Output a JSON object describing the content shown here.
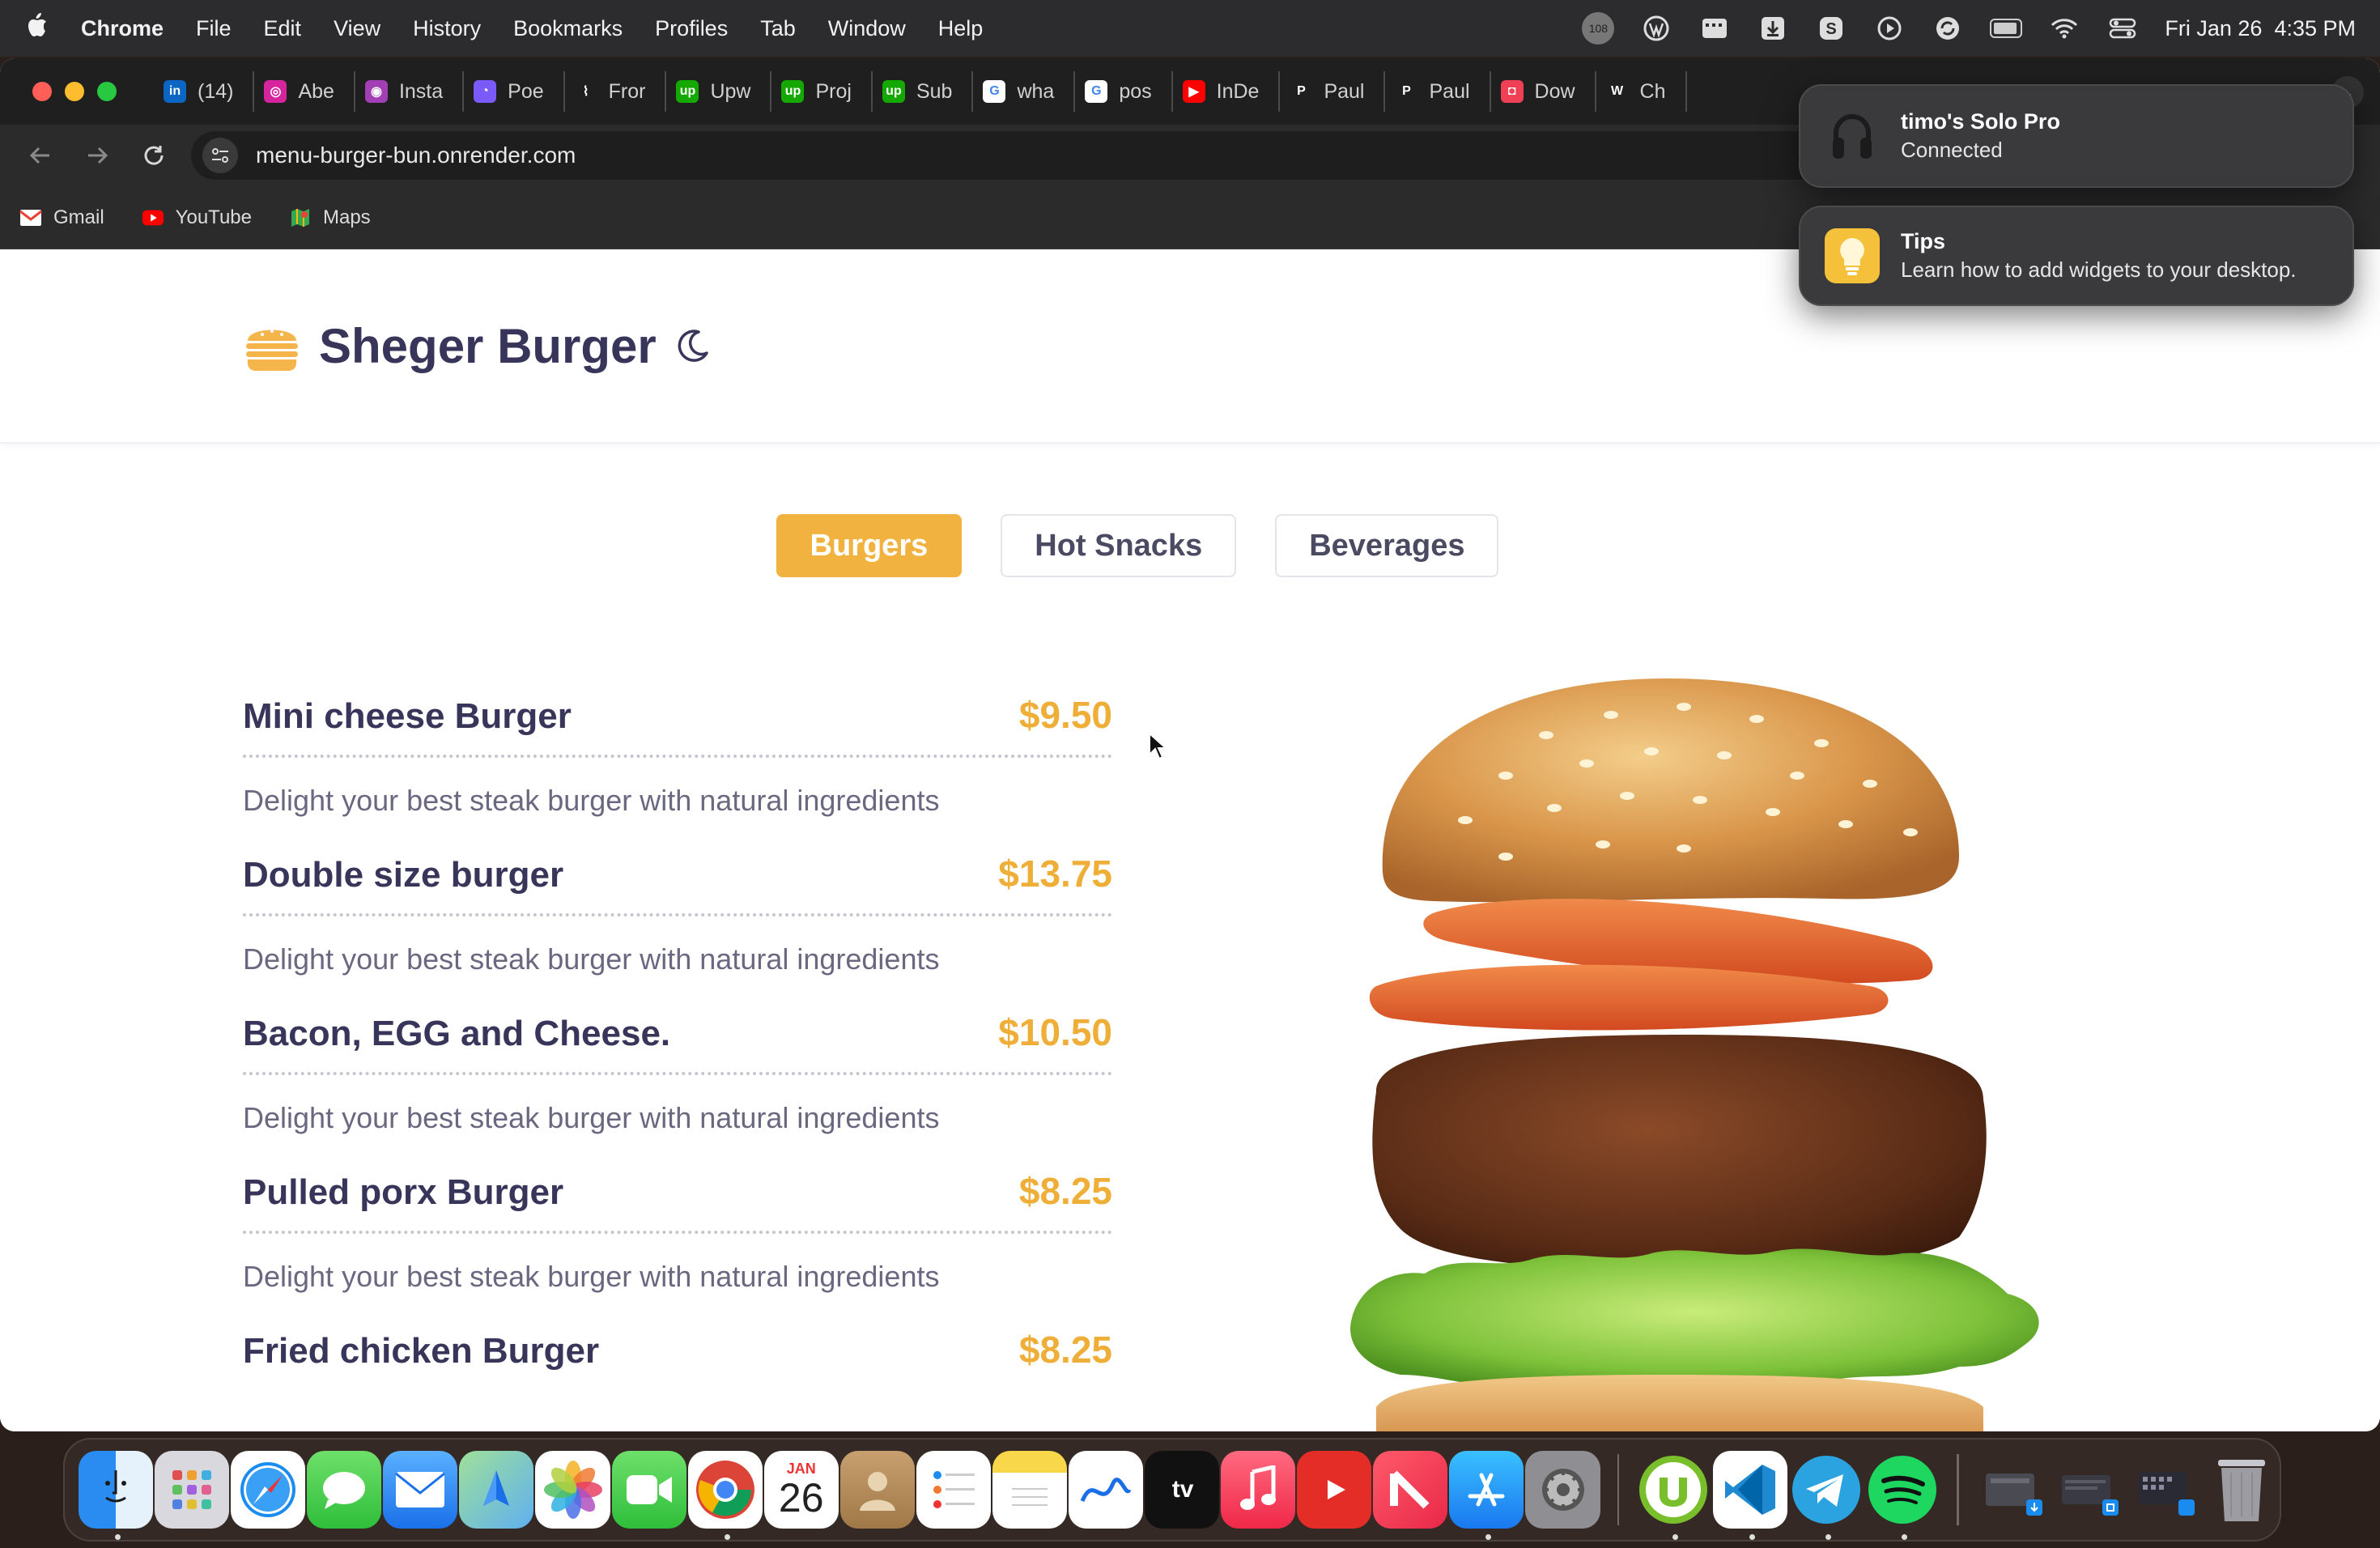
{
  "menubar": {
    "app_name": "Chrome",
    "menus": [
      "File",
      "Edit",
      "View",
      "History",
      "Bookmarks",
      "Profiles",
      "Tab",
      "Window",
      "Help"
    ],
    "badge_count": "108",
    "datetime": "Fri Jan 26  4:35 PM",
    "icons": [
      "notification-count-icon",
      "wordpress-icon",
      "finder-bar-icon",
      "download-icon",
      "s-icon",
      "play-icon",
      "sync-icon",
      "battery-icon",
      "wifi-icon",
      "control-center-icon"
    ]
  },
  "browser": {
    "tabs": [
      {
        "label": "(14)",
        "icon": "linkedin-icon",
        "color": "#0a66c2",
        "glyph": "in"
      },
      {
        "label": "Abe",
        "icon": "instagram-icon",
        "color": "#d6249f",
        "glyph": "◎"
      },
      {
        "label": "Insta",
        "icon": "instagram-gradient-icon",
        "color": "#a33fb5",
        "glyph": "◉"
      },
      {
        "label": "Poe",
        "icon": "poe-icon",
        "color": "#7a5af8",
        "glyph": "◔"
      },
      {
        "label": "Fror",
        "icon": "frontend-mentor-icon",
        "color": "#1f1f1f",
        "glyph": "⌇"
      },
      {
        "label": "Upw",
        "icon": "upwork-icon",
        "color": "#14a800",
        "glyph": "up"
      },
      {
        "label": "Proj",
        "icon": "upwork-icon",
        "color": "#14a800",
        "glyph": "up"
      },
      {
        "label": "Sub",
        "icon": "upwork-icon",
        "color": "#14a800",
        "glyph": "up"
      },
      {
        "label": "wha",
        "icon": "google-icon",
        "color": "#ffffff",
        "glyph": "G"
      },
      {
        "label": "pos",
        "icon": "google-icon",
        "color": "#ffffff",
        "glyph": "G"
      },
      {
        "label": "InDe",
        "icon": "youtube-icon",
        "color": "#ff0000",
        "glyph": "▶"
      },
      {
        "label": "Paul",
        "icon": "patreon-icon",
        "color": "#1f1f1f",
        "glyph": "P"
      },
      {
        "label": "Paul",
        "icon": "patreon-icon",
        "color": "#1f1f1f",
        "glyph": "P"
      },
      {
        "label": "Dow",
        "icon": "pocket-icon",
        "color": "#ef4056",
        "glyph": "◘"
      },
      {
        "label": "Ch",
        "icon": "wikipedia-icon",
        "color": "#1f1f1f",
        "glyph": "W"
      }
    ],
    "url": "menu-burger-bun.onrender.com",
    "bookmarks": [
      {
        "label": "Gmail",
        "icon": "gmail-icon"
      },
      {
        "label": "YouTube",
        "icon": "youtube-icon"
      },
      {
        "label": "Maps",
        "icon": "maps-icon"
      }
    ]
  },
  "site": {
    "title": "Sheger Burger",
    "categories": [
      {
        "label": "Burgers",
        "active": true
      },
      {
        "label": "Hot Snacks",
        "active": false
      },
      {
        "label": "Beverages",
        "active": false
      }
    ],
    "items": [
      {
        "name": "Mini cheese Burger",
        "price": "$9.50",
        "desc": "Delight your best steak burger with natural ingredients"
      },
      {
        "name": "Double size burger",
        "price": "$13.75",
        "desc": "Delight your best steak burger with natural ingredients"
      },
      {
        "name": "Bacon, EGG and Cheese.",
        "price": "$10.50",
        "desc": "Delight your best steak burger with natural ingredients"
      },
      {
        "name": "Pulled porx Burger",
        "price": "$8.25",
        "desc": "Delight your best steak burger with natural ingredients"
      },
      {
        "name": "Fried chicken Burger",
        "price": "$8.25",
        "desc": ""
      }
    ],
    "colors": {
      "accent": "#f2b23f",
      "heading": "#38355a",
      "price": "#eeae38"
    }
  },
  "notifications": [
    {
      "title": "timo's Solo Pro",
      "body": "Connected",
      "icon": "headphones-icon"
    },
    {
      "title": "Tips",
      "body": "Learn how to add widgets to your desktop.",
      "icon": "lightbulb-icon"
    }
  ],
  "dock": {
    "apps": [
      "finder-icon",
      "launchpad-icon",
      "safari-icon",
      "messages-icon",
      "mail-icon",
      "maps-icon",
      "photos-icon",
      "facetime-icon",
      "chrome-icon",
      "calendar-icon",
      "contacts-icon",
      "reminders-icon",
      "notes-icon",
      "freeform-icon",
      "apple-tv-icon",
      "music-icon",
      "youtube-icon",
      "news-icon",
      "app-store-icon",
      "system-settings-icon",
      "utorrent-icon",
      "vscode-icon",
      "telegram-icon",
      "spotify-icon",
      "downloads-stack-icon",
      "documents-stack-icon",
      "screenshots-stack-icon",
      "trash-icon"
    ],
    "calendar_month": "JAN",
    "calendar_day": "26",
    "apple_tv_label": "tv"
  }
}
